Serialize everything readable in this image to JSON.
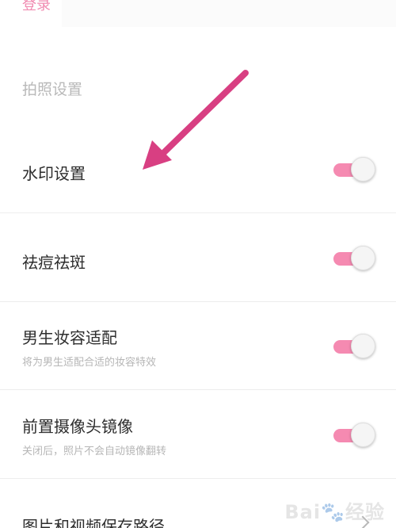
{
  "header": {
    "login_partial": "登录"
  },
  "section": {
    "title": "拍照设置"
  },
  "settings": [
    {
      "title": "水印设置",
      "subtitle": "",
      "enabled": true
    },
    {
      "title": "祛痘祛斑",
      "subtitle": "",
      "enabled": true
    },
    {
      "title": "男生妆容适配",
      "subtitle": "将为男生适配合适的妆容特效",
      "enabled": true
    },
    {
      "title": "前置摄像头镜像",
      "subtitle": "关闭后，照片不会自动镜像翻转",
      "enabled": true
    }
  ],
  "path_item": {
    "title": "图片和视频保存路径"
  },
  "colors": {
    "accent": "#f58ab1",
    "annotation_arrow": "#d83f82",
    "section_text": "#b9b9b9",
    "body_text": "#2d2d2d"
  },
  "icons": {
    "arrow_annotation": "arrow-icon",
    "path_chevron": "chevron-right-icon"
  }
}
